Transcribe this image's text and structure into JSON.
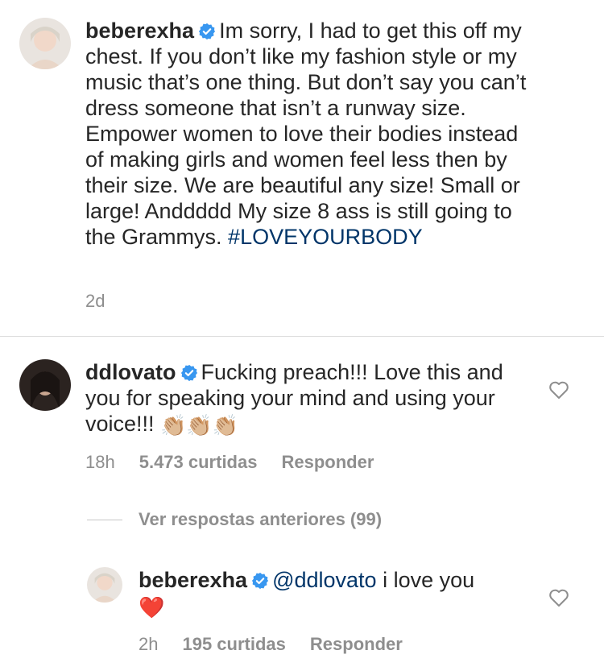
{
  "post": {
    "username": "beberexha",
    "caption": "Im sorry, I had to get this off my chest. If you don’t like my fashion style or my music that’s one thing. But don’t say you can’t dress someone that isn’t a runway size. Empower women to love their bodies instead of making girls and women feel less then by their size. We are beautiful any size! Small or large! Anddddd My size 8 ass is still going to the Grammys.",
    "hashtag": "#LOVEYOURBODY",
    "time": "2d"
  },
  "comment": {
    "username": "ddlovato",
    "text": "Fucking preach!!! Love this and you for speaking your mind and using your voice!!!",
    "emoji": "👏🏼👏🏼👏🏼",
    "time": "18h",
    "likes": "5.473 curtidas",
    "reply_label": "Responder"
  },
  "view_previous": "Ver respostas anteriores (99)",
  "reply": {
    "username": "beberexha",
    "mention": "@ddlovato",
    "text": "i love you",
    "emoji": "❤️",
    "time": "2h",
    "likes": "195 curtidas",
    "reply_label": "Responder"
  },
  "colors": {
    "verified_badge": "#3897f0",
    "hashtag_link": "#003569",
    "muted_text": "#8e8e8e"
  }
}
